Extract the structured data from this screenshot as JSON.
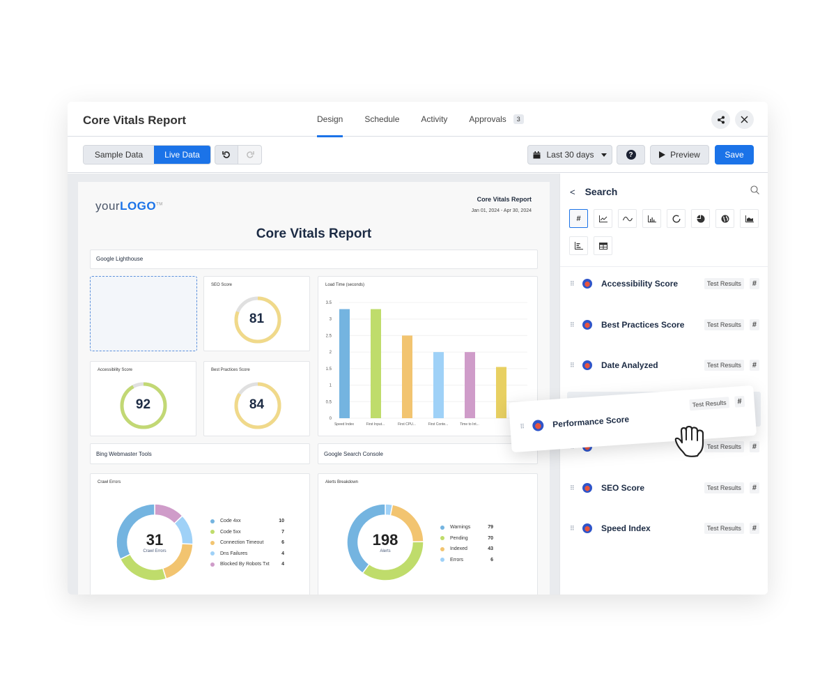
{
  "header": {
    "title": "Core Vitals Report",
    "tabs": [
      {
        "label": "Design",
        "active": true
      },
      {
        "label": "Schedule"
      },
      {
        "label": "Activity"
      },
      {
        "label": "Approvals",
        "badge": "3"
      }
    ],
    "share_icon": "share-icon",
    "close_icon": "close-icon"
  },
  "toolbar": {
    "sample_data": "Sample Data",
    "live_data": "Live Data",
    "date_range": "Last 30 days",
    "help": "?",
    "preview": "Preview",
    "save": "Save"
  },
  "report": {
    "logo_prefix": "your",
    "logo_main": "LOGO",
    "logo_tm": "TM",
    "header_title": "Core Vitals Report",
    "header_dates": "Jan 01, 2024 - Apr 30, 2024",
    "title": "Core Vitals Report",
    "sections": {
      "lighthouse": "Google Lighthouse",
      "bing": "Bing Webmaster Tools",
      "gsc": "Google Search Console"
    },
    "gauges": [
      {
        "label": "SEO Score",
        "value": 81,
        "color": "#f0d98a"
      },
      {
        "label": "Accessibility Score",
        "value": 92,
        "color": "#c2d874"
      },
      {
        "label": "Best Practices Score",
        "value": 84,
        "color": "#f0d98a"
      }
    ]
  },
  "chart_data": [
    {
      "type": "bar",
      "title": "Load Time (seconds)",
      "categories": [
        "Speed Index",
        "First Input...",
        "First CPU...",
        "First Conte...",
        "Time to Int...",
        ""
      ],
      "values": [
        3.3,
        3.3,
        2.5,
        2.0,
        2.0,
        1.55
      ],
      "colors": [
        "#74b4e0",
        "#bfdc6b",
        "#f2c470",
        "#9fd1f7",
        "#cf9cc9",
        "#e8d062"
      ],
      "ylim": [
        0,
        3.5
      ],
      "yticks": [
        "0",
        "0.5",
        "1",
        "1.5",
        "2",
        "2.5",
        "3",
        "3.5"
      ],
      "grid": true
    },
    {
      "type": "pie",
      "title": "Crawl Errors",
      "center_value": "31",
      "center_label": "Crawl Errors",
      "categories": [
        "Code 4xx",
        "Code 5xx",
        "Connection Timeout",
        "Dns Failures",
        "Blocked By Robots Txt"
      ],
      "values": [
        10,
        7,
        6,
        4,
        4
      ],
      "colors": [
        "#74b4e0",
        "#bfdc6b",
        "#f2c470",
        "#9fd1f7",
        "#cf9cc9"
      ],
      "legend": "right"
    },
    {
      "type": "pie",
      "title": "Alerts Breakdown",
      "center_value": "198",
      "center_label": "Alerts",
      "categories": [
        "Warnings",
        "Pending",
        "Indexed",
        "Errors"
      ],
      "values": [
        79,
        70,
        43,
        6
      ],
      "colors": [
        "#74b4e0",
        "#bfdc6b",
        "#f2c470",
        "#9fd1f7"
      ],
      "legend": "right"
    }
  ],
  "panel": {
    "back": "<",
    "title": "Search",
    "viz_types": [
      "number-icon",
      "line-chart-icon",
      "sparkline-icon",
      "bar-chart-icon",
      "donut-icon",
      "pie-icon",
      "map-globe-icon",
      "area-chart-icon",
      "horizontal-bar-icon",
      "table-icon"
    ],
    "metrics": [
      {
        "name": "Accessibility Score",
        "tag": "Test Results",
        "type": "#"
      },
      {
        "name": "Best Practices Score",
        "tag": "Test Results",
        "type": "#"
      },
      {
        "name": "Date Analyzed",
        "tag": "Test Results",
        "type": "#"
      },
      {
        "name": "",
        "tag": "Test Results",
        "type": "#"
      },
      {
        "name": "SEO Score",
        "tag": "Test Results",
        "type": "#"
      },
      {
        "name": "Speed Index",
        "tag": "Test Results",
        "type": "#"
      }
    ],
    "dragging": {
      "name": "Performance Score",
      "tag": "Test Results",
      "type": "#"
    }
  }
}
